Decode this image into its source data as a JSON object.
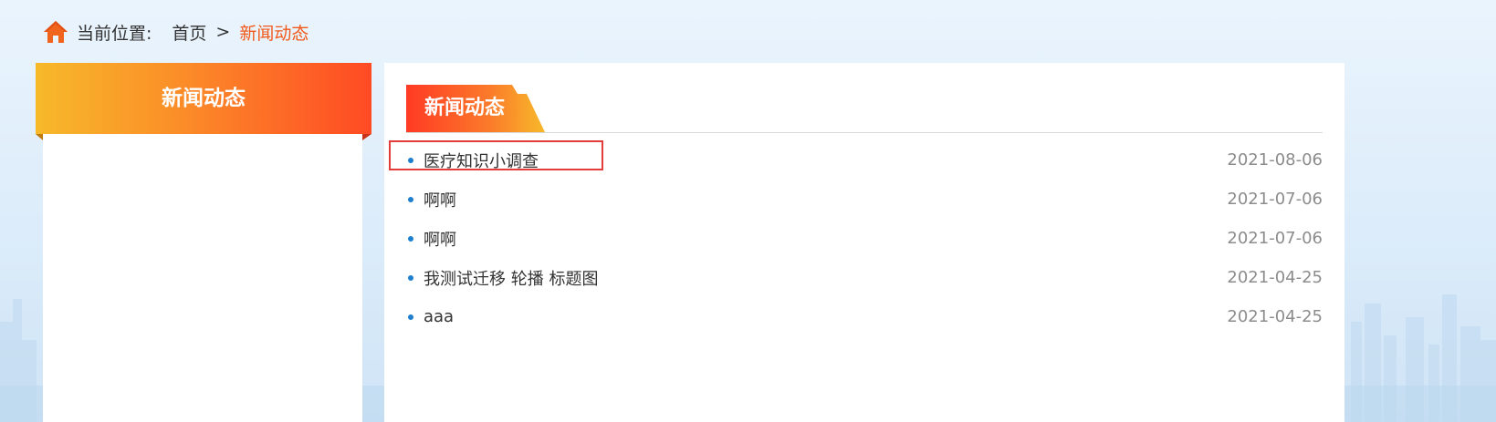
{
  "breadcrumb": {
    "prefix": "当前位置:",
    "home": "首页",
    "separator": ">",
    "current": "新闻动态"
  },
  "sidebar": {
    "title": "新闻动态"
  },
  "main": {
    "section_title": "新闻动态",
    "news": [
      {
        "title": "医疗知识小调查",
        "date": "2021-08-06"
      },
      {
        "title": "啊啊",
        "date": "2021-07-06"
      },
      {
        "title": "啊啊",
        "date": "2021-07-06"
      },
      {
        "title": "我测试迁移 轮播 标题图",
        "date": "2021-04-25"
      },
      {
        "title": "aaa",
        "date": "2021-04-25"
      }
    ]
  },
  "colors": {
    "accent_orange": "#f25a1c",
    "bullet_blue": "#1f7fcf",
    "highlight_red": "#e43b3b"
  }
}
